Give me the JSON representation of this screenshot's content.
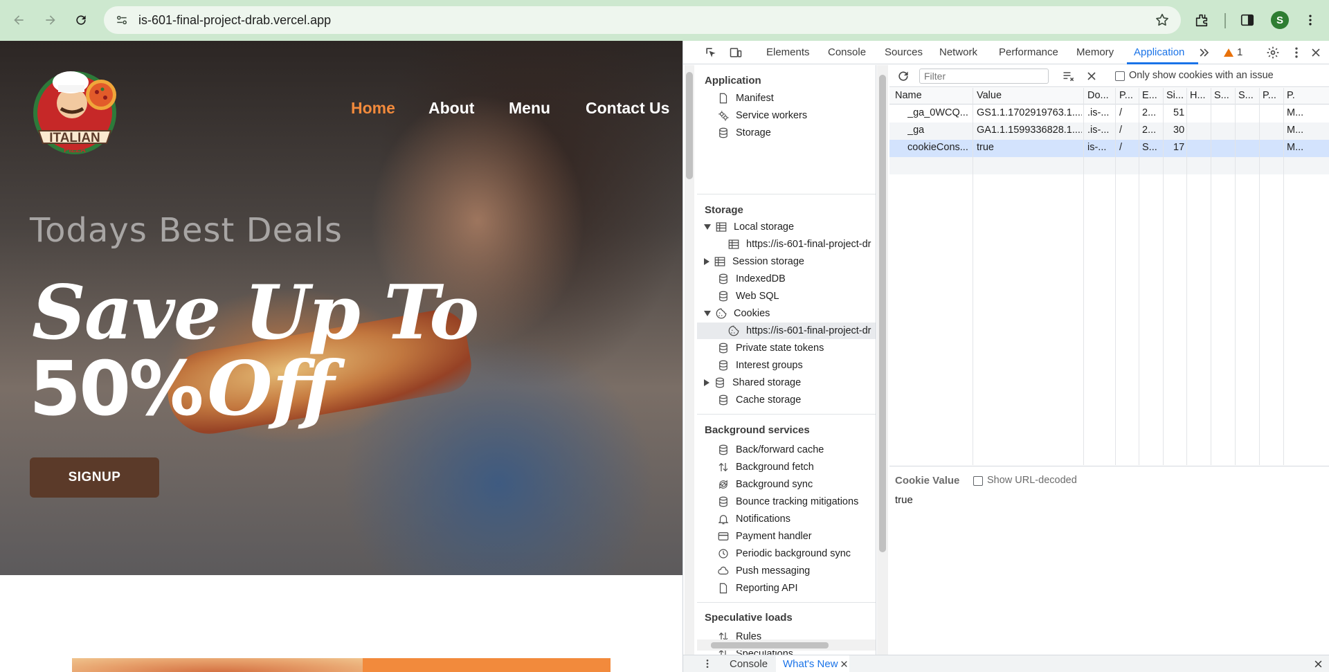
{
  "browser": {
    "url": "is-601-final-project-drab.vercel.app",
    "profile_initial": "S",
    "icons": [
      "back-icon",
      "forward-icon",
      "reload-icon",
      "site-settings-icon",
      "bookmark-star-icon",
      "extensions-icon",
      "side-panel-icon",
      "menu-kebab-icon"
    ]
  },
  "site": {
    "logo_text": "ITALIAN PIZZA",
    "nav": [
      {
        "label": "Home",
        "active": true
      },
      {
        "label": "About",
        "active": false
      },
      {
        "label": "Menu",
        "active": false
      },
      {
        "label": "Contact Us",
        "active": false
      }
    ],
    "hero_kicker": "Todays Best Deals",
    "hero_line1": "Save Up To",
    "hero_pct": "50%",
    "hero_off": "Off",
    "cta_label": "SIGNUP",
    "accent_color": "#f28a3c",
    "cta_color": "#5b3a29"
  },
  "devtools": {
    "tabs": [
      "Elements",
      "Console",
      "Sources",
      "Network",
      "Performance",
      "Memory",
      "Application"
    ],
    "active_tab": "Application",
    "warning_count": "1",
    "sidebar": {
      "application_title": "Application",
      "application_items": [
        "Manifest",
        "Service workers",
        "Storage"
      ],
      "storage_title": "Storage",
      "storage_items": {
        "local_storage": "Local storage",
        "local_storage_origin": "https://is-601-final-project-dr",
        "session_storage": "Session storage",
        "indexeddb": "IndexedDB",
        "websql": "Web SQL",
        "cookies": "Cookies",
        "cookies_origin": "https://is-601-final-project-dr",
        "private_state_tokens": "Private state tokens",
        "interest_groups": "Interest groups",
        "shared_storage": "Shared storage",
        "cache_storage": "Cache storage"
      },
      "background_title": "Background services",
      "background_items": [
        "Back/forward cache",
        "Background fetch",
        "Background sync",
        "Bounce tracking mitigations",
        "Notifications",
        "Payment handler",
        "Periodic background sync",
        "Push messaging",
        "Reporting API"
      ],
      "speculative_title": "Speculative loads",
      "speculative_items": [
        "Rules",
        "Speculations"
      ]
    },
    "cookies": {
      "filter_placeholder": "Filter",
      "only_issue_label": "Only show cookies with an issue",
      "columns": [
        "Name",
        "Value",
        "Do...",
        "P...",
        "E...",
        "Si...",
        "H...",
        "S...",
        "S...",
        "P...",
        "P."
      ],
      "rows": [
        [
          "_ga_0WCQ...",
          "GS1.1.1702919763.1....",
          ".is-...",
          "/",
          "2...",
          "51",
          "",
          "",
          "",
          "",
          "M..."
        ],
        [
          "_ga",
          "GA1.1.1599336828.1....",
          ".is-...",
          "/",
          "2...",
          "30",
          "",
          "",
          "",
          "",
          "M..."
        ],
        [
          "cookieCons...",
          "true",
          "is-...",
          "/",
          "S...",
          "17",
          "",
          "",
          "",
          "",
          "M..."
        ]
      ],
      "selected_row": 2,
      "cookie_value_title": "Cookie Value",
      "show_url_decoded": "Show URL-decoded",
      "cookie_value": "true"
    },
    "drawer": {
      "tabs": [
        "Console",
        "What's New"
      ],
      "active": "What's New"
    }
  }
}
